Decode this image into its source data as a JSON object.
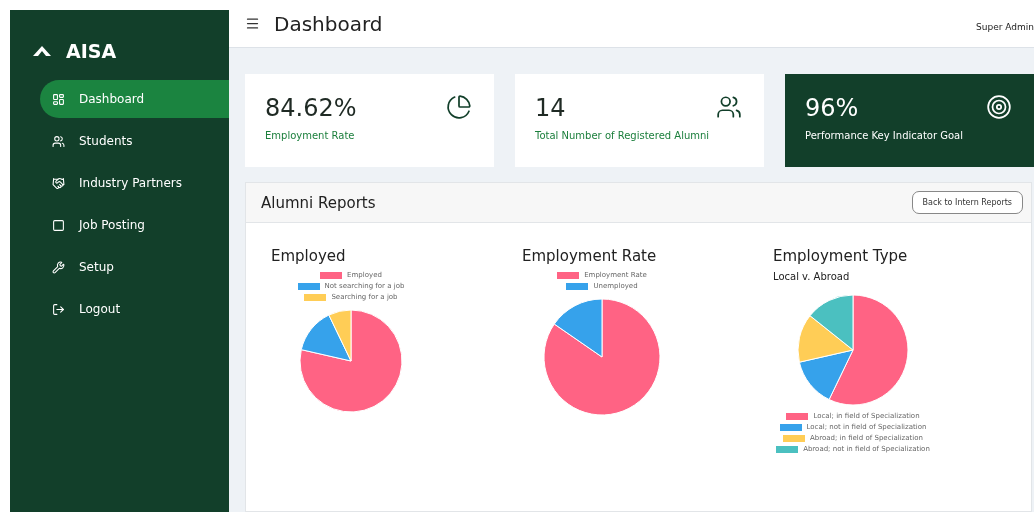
{
  "sidebar": {
    "brand": "AISA",
    "items": [
      {
        "label": "Dashboard",
        "selected": true
      },
      {
        "label": "Students",
        "selected": false
      },
      {
        "label": "Industry Partners",
        "selected": false
      },
      {
        "label": "Job Posting",
        "selected": false
      },
      {
        "label": "Setup",
        "selected": false
      },
      {
        "label": "Logout",
        "selected": false
      }
    ]
  },
  "header": {
    "title": "Dashboard",
    "user": "Super Admin"
  },
  "stats": [
    {
      "value": "84.62%",
      "label": "Employment Rate",
      "kind": "light"
    },
    {
      "value": "14",
      "label": "Total Number of Registered Alumni",
      "kind": "light"
    },
    {
      "value": "96%",
      "label": "Performance Key Indicator Goal",
      "kind": "dark"
    }
  ],
  "reports": {
    "title": "Alumni Reports",
    "back_button": "Back to Intern Reports",
    "charts": [
      {
        "kind": "legend-top",
        "chart_data": {
          "type": "pie",
          "title": "Employed",
          "categories": [
            "Employed",
            "Not searching for a job",
            "Searching for a job"
          ],
          "values": [
            78.57,
            14.29,
            7.14
          ],
          "colors": [
            "#ff6384",
            "#36a2eb",
            "#ffcd56"
          ]
        }
      },
      {
        "kind": "legend-top",
        "chart_data": {
          "type": "pie",
          "title": "Employment Rate",
          "categories": [
            "Employment Rate",
            "Unemployed"
          ],
          "values": [
            84.62,
            15.38
          ],
          "colors": [
            "#ff6384",
            "#36a2eb"
          ]
        }
      },
      {
        "kind": "legend-bottom",
        "subtitle": "Local v. Abroad",
        "chart_data": {
          "type": "pie",
          "title": "Employment Type",
          "categories": [
            "Local; in field of Specialization",
            "Local; not in field of Specialization",
            "Abroad; in field of Specialization",
            "Abroad; not in field of Specialization"
          ],
          "values": [
            57.15,
            14.29,
            14.28,
            14.28
          ],
          "colors": [
            "#ff6384",
            "#36a2eb",
            "#ffcd56",
            "#4bc0c0"
          ]
        }
      }
    ]
  }
}
